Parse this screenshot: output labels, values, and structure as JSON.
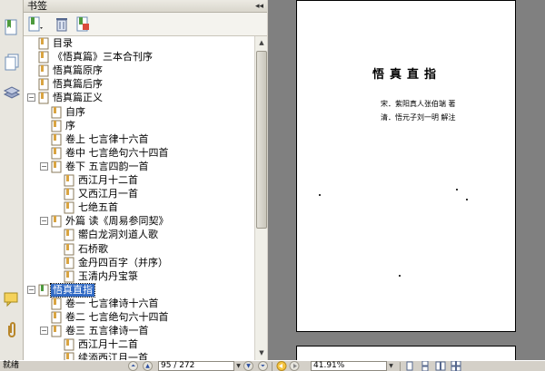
{
  "panel": {
    "title": "书签",
    "collapse_glyph": "◂◂"
  },
  "toolbar": {
    "icons": [
      "bookmark-options-icon",
      "delete-bookmark-icon",
      "new-bookmark-icon"
    ]
  },
  "side_icons": [
    "bookmarks-panel-icon",
    "pages-panel-icon",
    "layers-panel-icon",
    "comments-panel-icon",
    "attachments-panel-icon"
  ],
  "bookmarks": [
    {
      "label": "目录",
      "level": 1,
      "expander": ""
    },
    {
      "label": "《悟真篇》三本合刊序",
      "level": 1,
      "expander": ""
    },
    {
      "label": "悟真篇原序",
      "level": 1,
      "expander": ""
    },
    {
      "label": "悟真篇后序",
      "level": 1,
      "expander": ""
    },
    {
      "label": "悟真篇正义",
      "level": 1,
      "expander": "−"
    },
    {
      "label": "自序",
      "level": 2,
      "expander": ""
    },
    {
      "label": "序",
      "level": 2,
      "expander": ""
    },
    {
      "label": "卷上 七言律十六首",
      "level": 2,
      "expander": ""
    },
    {
      "label": "卷中 七言绝句六十四首",
      "level": 2,
      "expander": ""
    },
    {
      "label": "卷下 五言四韵一首",
      "level": 2,
      "expander": "−"
    },
    {
      "label": "西江月十二首",
      "level": 3,
      "expander": ""
    },
    {
      "label": "又西江月一首",
      "level": 3,
      "expander": ""
    },
    {
      "label": "七绝五首",
      "level": 3,
      "expander": ""
    },
    {
      "label": "外篇 读《周易参同契》",
      "level": 2,
      "expander": "−"
    },
    {
      "label": "嚮白龙洞刘道人歌",
      "level": 3,
      "expander": ""
    },
    {
      "label": "石桥歌",
      "level": 3,
      "expander": ""
    },
    {
      "label": "金丹四百字（并序）",
      "level": 3,
      "expander": ""
    },
    {
      "label": "玉清内丹宝箓",
      "level": 3,
      "expander": ""
    },
    {
      "label": "悟真直指",
      "level": 1,
      "expander": "−",
      "selected": true
    },
    {
      "label": "卷一 七言律诗十六首",
      "level": 2,
      "expander": ""
    },
    {
      "label": "卷二 七言绝句六十四首",
      "level": 2,
      "expander": ""
    },
    {
      "label": "卷三 五言律诗一首",
      "level": 2,
      "expander": "−"
    },
    {
      "label": "西江月十二首",
      "level": 3,
      "expander": ""
    },
    {
      "label": "续添西江月一首",
      "level": 3,
      "expander": ""
    }
  ],
  "document": {
    "title": "悟真直指",
    "author_line_1": "宋．紫阳真人张伯端 著",
    "author_line_2": "清．悟元子刘一明 解注"
  },
  "status": {
    "ready_text": "就绪",
    "page_display": "95 / 272",
    "zoom_display": "41.91%",
    "nav_buttons": [
      "first-page-icon",
      "previous-page-icon",
      "next-page-icon",
      "last-page-icon"
    ],
    "view_buttons": [
      "single-page-icon",
      "continuous-icon",
      "facing-icon",
      "continuous-facing-icon"
    ]
  },
  "colors": {
    "selection": "#316ac5",
    "document_background": "#808080",
    "panel_background": "#ffffff"
  }
}
